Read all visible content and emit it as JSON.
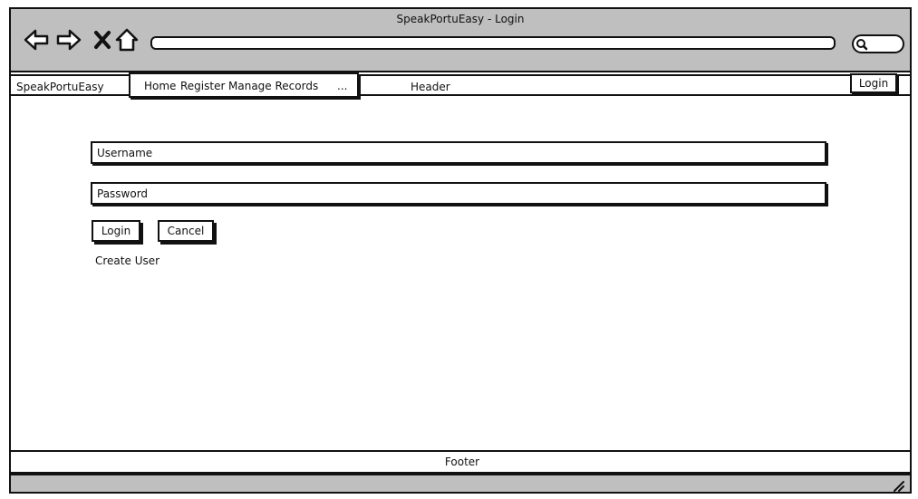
{
  "window": {
    "title": "SpeakPortuEasy - Login",
    "address_value": ""
  },
  "header": {
    "brand": "SpeakPortuEasy",
    "menu": {
      "items": [
        "Home",
        "Register",
        "Manage Records",
        "..."
      ]
    },
    "label": "Header",
    "login_label": "Login"
  },
  "form": {
    "username_placeholder": "Username",
    "password_placeholder": "Password",
    "login_label": "Login",
    "cancel_label": "Cancel",
    "create_user_label": "Create User"
  },
  "footer": {
    "label": "Footer"
  },
  "icons": {
    "back": "back-arrow-icon",
    "forward": "forward-arrow-icon",
    "stop": "close-icon",
    "home": "home-icon",
    "search": "search-icon",
    "resize": "resize-grip-icon"
  },
  "colors": {
    "chrome": "#bfbfbf",
    "stroke": "#111111",
    "background": "#ffffff"
  }
}
